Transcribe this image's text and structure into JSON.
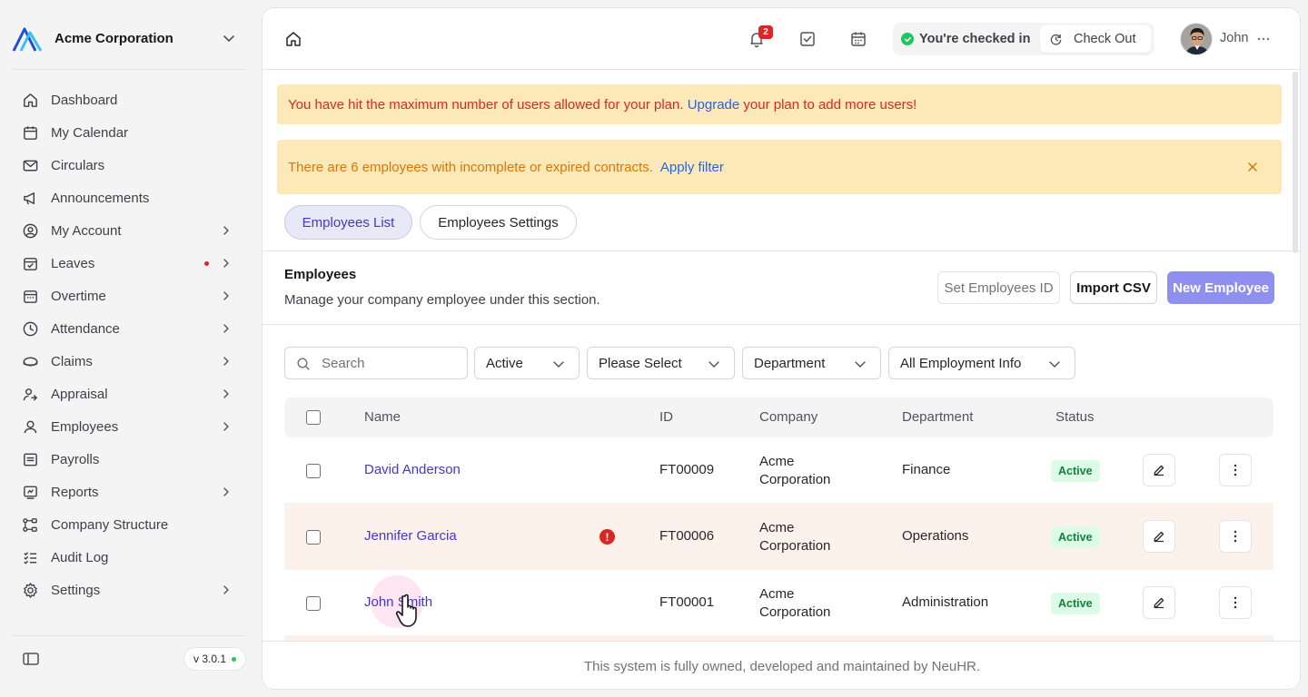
{
  "org": {
    "name": "Acme Corporation"
  },
  "nav": [
    {
      "label": "Dashboard",
      "icon": "home-icon",
      "chevron": false
    },
    {
      "label": "My Calendar",
      "icon": "calendar-icon",
      "chevron": false
    },
    {
      "label": "Circulars",
      "icon": "mail-icon",
      "chevron": false
    },
    {
      "label": "Announcements",
      "icon": "megaphone-icon",
      "chevron": false
    },
    {
      "label": "My Account",
      "icon": "user-circle-icon",
      "chevron": true
    },
    {
      "label": "Leaves",
      "icon": "calendar-check-icon",
      "chevron": true,
      "dot": true
    },
    {
      "label": "Overtime",
      "icon": "calendar-clock-icon",
      "chevron": true
    },
    {
      "label": "Attendance",
      "icon": "clock-icon",
      "chevron": true
    },
    {
      "label": "Claims",
      "icon": "coins-icon",
      "chevron": true
    },
    {
      "label": "Appraisal",
      "icon": "user-star-icon",
      "chevron": true
    },
    {
      "label": "Employees",
      "icon": "user-icon",
      "chevron": true
    },
    {
      "label": "Payrolls",
      "icon": "receipt-icon",
      "chevron": false
    },
    {
      "label": "Reports",
      "icon": "report-icon",
      "chevron": true
    },
    {
      "label": "Company Structure",
      "icon": "hierarchy-icon",
      "chevron": false
    },
    {
      "label": "Audit Log",
      "icon": "list-check-icon",
      "chevron": false
    },
    {
      "label": "Settings",
      "icon": "gear-icon",
      "chevron": true
    }
  ],
  "version": "v 3.0.1",
  "topbar": {
    "notification_count": "2",
    "checked_in_text": "You're checked in",
    "checkout_label": "Check Out",
    "user_name": "John"
  },
  "alerts": {
    "limit_before": "You have hit the maximum number of users allowed for your plan.",
    "limit_link": "Upgrade",
    "limit_after": "your plan to add more users!",
    "contracts_text": "There are 6 employees with incomplete or expired contracts.",
    "contracts_link": "Apply filter"
  },
  "tabs": {
    "list": "Employees List",
    "settings": "Employees Settings"
  },
  "section": {
    "title": "Employees",
    "subtitle": "Manage your company employee under this section.",
    "set_id_label": "Set Employees ID",
    "import_label": "Import CSV",
    "new_label": "New Employee"
  },
  "filters": {
    "search_placeholder": "Search",
    "status": "Active",
    "please_select": "Please Select",
    "department": "Department",
    "employment": "All Employment Info"
  },
  "table": {
    "headers": {
      "name": "Name",
      "id": "ID",
      "company": "Company",
      "department": "Department",
      "status": "Status"
    },
    "rows": [
      {
        "name": "David Anderson",
        "id": "FT00009",
        "company_line1": "Acme",
        "company_line2": "Corporation",
        "department": "Finance",
        "status": "Active"
      },
      {
        "name": "Jennifer Garcia",
        "id": "FT00006",
        "company_line1": "Acme",
        "company_line2": "Corporation",
        "department": "Operations",
        "status": "Active",
        "warning": "!"
      },
      {
        "name": "John Smith",
        "id": "FT00001",
        "company_line1": "Acme",
        "company_line2": "Corporation",
        "department": "Administration",
        "status": "Active"
      }
    ]
  },
  "footer": "This system is fully owned, developed and maintained by NeuHR.",
  "colors": {
    "accent": "#4338ca",
    "primary_button": "#8f8ff0",
    "alert_bg": "#fde9b8",
    "danger": "#dc2626",
    "warning_text": "#d97706",
    "active_badge": "#15803d"
  }
}
